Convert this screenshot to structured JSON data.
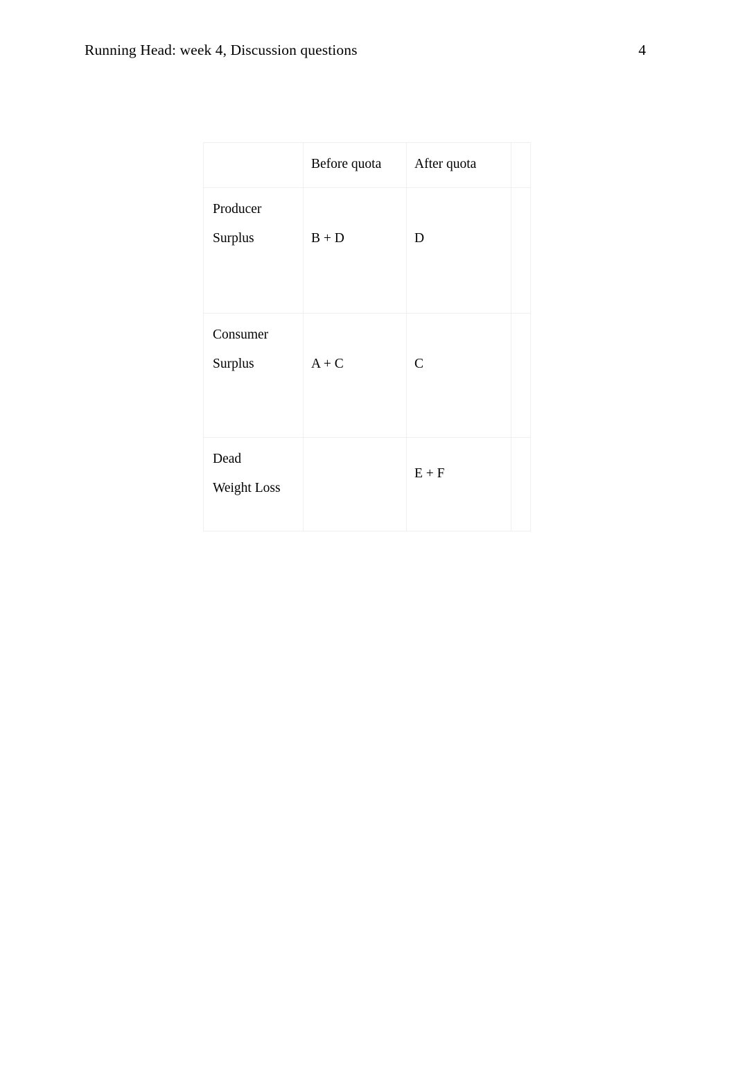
{
  "header": {
    "running_head": "Running Head: week 4, Discussion questions",
    "page_number": "4"
  },
  "table": {
    "columns": [
      "",
      "Before quota",
      "After quota",
      ""
    ],
    "rows": [
      {
        "label_line1": "Producer",
        "label_line2": "Surplus",
        "before_quota": "B + D",
        "after_quota": "D",
        "extra": ""
      },
      {
        "label_line1": "Consumer",
        "label_line2": "Surplus",
        "before_quota": "A + C",
        "after_quota": "C",
        "extra": ""
      },
      {
        "label_line1": "Dead",
        "label_line2": "Weight Loss",
        "before_quota": "",
        "after_quota": "E + F",
        "extra": ""
      }
    ]
  },
  "colors": {
    "text": "#000000",
    "page_background": "#ffffff",
    "table_border": "#efefef"
  }
}
